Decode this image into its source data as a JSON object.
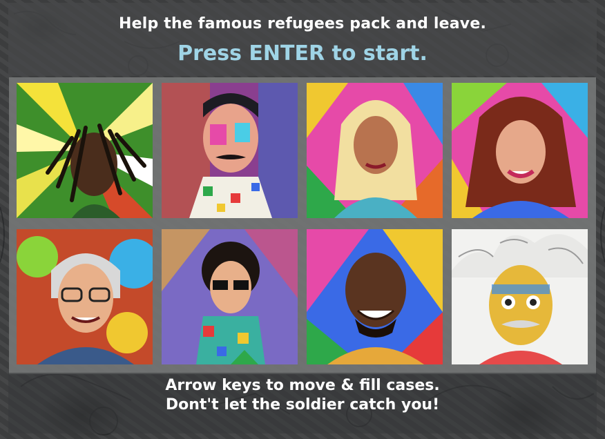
{
  "header": {
    "title": "Help the famous refugees pack and leave.",
    "start_prompt": "Press ENTER to start."
  },
  "instructions": {
    "line1": "Arrow keys to move & fill cases.",
    "line2": "Dont't let the soldier catch you!"
  },
  "colors": {
    "title_text": "#ffffff",
    "start_prompt_text": "#9fd4e6",
    "panel_grey": "#7a7c7c"
  },
  "portraits": [
    {
      "icon": "dreadlocks-man-portrait"
    },
    {
      "icon": "mustache-man-portrait"
    },
    {
      "icon": "blonde-woman-portrait"
    },
    {
      "icon": "curly-hair-woman-portrait"
    },
    {
      "icon": "glasses-grey-hair-man-portrait"
    },
    {
      "icon": "curly-hair-sunglasses-man-portrait"
    },
    {
      "icon": "bald-smiling-man-portrait"
    },
    {
      "icon": "wild-white-hair-scientist-portrait"
    }
  ]
}
